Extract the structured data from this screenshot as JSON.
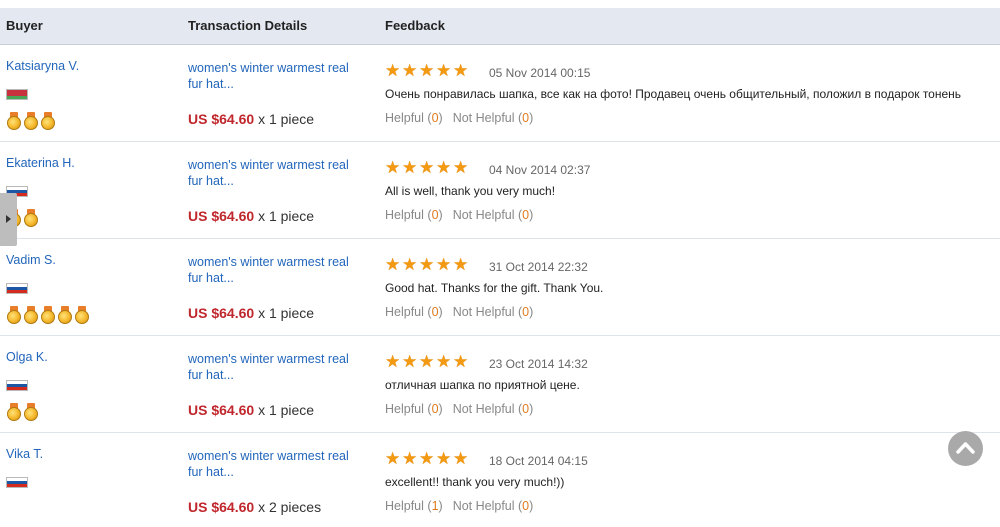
{
  "header": {
    "buyer": "Buyer",
    "transaction": "Transaction Details",
    "feedback": "Feedback"
  },
  "rows": [
    {
      "buyer": "Katsiaryna V.",
      "flag": [
        "#c8313e",
        "#c8313e",
        "#4aa657"
      ],
      "medals": 3,
      "item": "women's winter warmest real fur hat...",
      "price": "US $64.60",
      "qty": "x 1 piece",
      "rating": 5,
      "date": "05 Nov 2014 00:15",
      "comment": "Очень понравилась шапка, все как на фото! Продавец очень общительный, положил в подарок тонень",
      "helpful_label": "Helpful",
      "helpful_count": "0",
      "not_helpful_label": "Not Helpful",
      "not_helpful_count": "0"
    },
    {
      "buyer": "Ekaterina H.",
      "flag": [
        "#ffffff",
        "#1c57a5",
        "#d52b1e"
      ],
      "medals": 2,
      "item": "women's winter warmest real fur hat...",
      "price": "US $64.60",
      "qty": "x 1 piece",
      "rating": 5,
      "date": "04 Nov 2014 02:37",
      "comment": "All is well, thank you very much!",
      "helpful_label": "Helpful",
      "helpful_count": "0",
      "not_helpful_label": "Not Helpful",
      "not_helpful_count": "0"
    },
    {
      "buyer": "Vadim S.",
      "flag": [
        "#ffffff",
        "#1c57a5",
        "#d52b1e"
      ],
      "medals": 5,
      "item": "women's winter warmest real fur hat...",
      "price": "US $64.60",
      "qty": "x 1 piece",
      "rating": 5,
      "date": "31 Oct 2014 22:32",
      "comment": "Good hat. Thanks for the gift. Thank You.",
      "helpful_label": "Helpful",
      "helpful_count": "0",
      "not_helpful_label": "Not Helpful",
      "not_helpful_count": "0"
    },
    {
      "buyer": "Olga K.",
      "flag": [
        "#ffffff",
        "#1c57a5",
        "#d52b1e"
      ],
      "medals": 2,
      "item": "women's winter warmest real fur hat...",
      "price": "US $64.60",
      "qty": "x 1 piece",
      "rating": 5,
      "date": "23 Oct 2014 14:32",
      "comment": "отличная шапка по приятной цене.",
      "helpful_label": "Helpful",
      "helpful_count": "0",
      "not_helpful_label": "Not Helpful",
      "not_helpful_count": "0"
    },
    {
      "buyer": "Vika T.",
      "flag": [
        "#ffffff",
        "#1c57a5",
        "#d52b1e"
      ],
      "medals": 0,
      "item": "women's winter warmest real fur hat...",
      "price": "US $64.60",
      "qty": "x 2 pieces",
      "rating": 5,
      "date": "18 Oct 2014 04:15",
      "comment": "excellent!! thank you very much!))",
      "helpful_label": "Helpful",
      "helpful_count": "1",
      "not_helpful_label": "Not Helpful",
      "not_helpful_count": "0"
    }
  ],
  "icons": {
    "side_tab": "chevron-right-icon",
    "scroll_top": "chevron-up-icon",
    "medal": "medal-icon",
    "star": "star-icon",
    "flag": "country-flag-icon"
  },
  "colors": {
    "link": "#2266bb",
    "price": "#c0272d",
    "star": "#f39a12",
    "count": "#e07b20",
    "header_bg": "#e4e8f1"
  }
}
